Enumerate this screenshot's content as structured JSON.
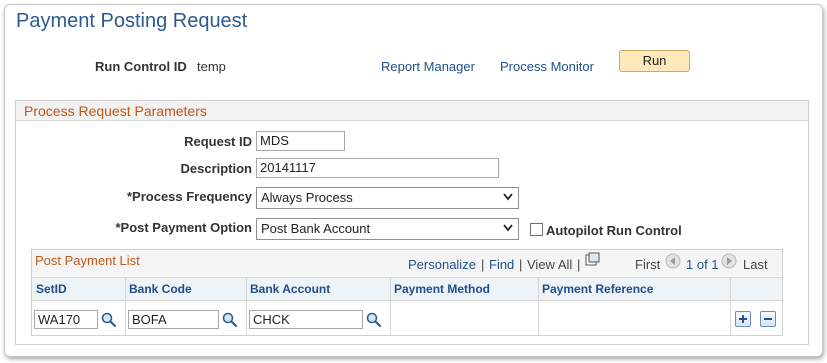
{
  "page": {
    "title": "Payment Posting Request"
  },
  "header": {
    "run_control_label": "Run Control ID",
    "run_control_value": "temp",
    "report_manager": "Report Manager",
    "process_monitor": "Process Monitor",
    "run_label": "Run"
  },
  "params": {
    "group_title": "Process Request Parameters",
    "request_id_label": "Request ID",
    "request_id_value": "MDS",
    "description_label": "Description",
    "description_value": "20141117",
    "frequency_label": "*Process Frequency",
    "frequency_value": "Always Process",
    "post_option_label": "*Post Payment Option",
    "post_option_value": "Post Bank Account",
    "autopilot_label": "Autopilot Run Control",
    "autopilot_checked": false
  },
  "grid": {
    "title": "Post Payment List",
    "personalize": "Personalize",
    "sep1": "|",
    "find": "Find",
    "sep2": "|",
    "view_all": "View All",
    "sep3": "|",
    "first": "First",
    "range": "1 of 1",
    "last": "Last",
    "columns": [
      "SetID",
      "Bank Code",
      "Bank Account",
      "Payment Method",
      "Payment Reference"
    ],
    "rows": [
      {
        "setid": "WA170",
        "bank_code": "BOFA",
        "bank_account": "CHCK",
        "payment_method": "",
        "payment_reference": ""
      }
    ]
  },
  "icons": {
    "lookup": "magnifier-icon",
    "add_row": "plus-icon",
    "delete_row": "minus-icon",
    "new_window": "new-window-icon",
    "prev": "left-arrow-icon",
    "next": "right-arrow-icon"
  },
  "colors": {
    "title": "#2d5a8e",
    "section_title": "#c0571a",
    "link": "#1f4e8c",
    "run_button": "#fde9b9"
  }
}
